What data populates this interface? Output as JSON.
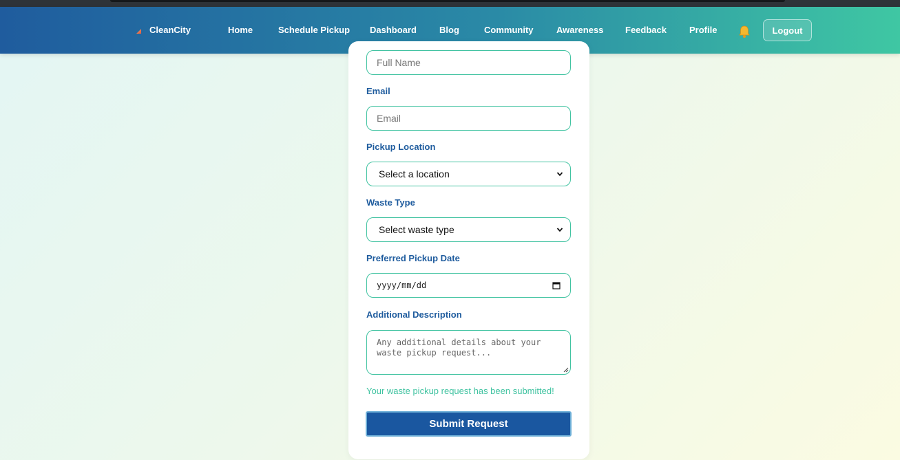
{
  "nav": {
    "brand": "CleanCity",
    "links": [
      "Home",
      "Schedule Pickup",
      "Dashboard",
      "Blog",
      "Community",
      "Awareness",
      "Feedback",
      "Profile"
    ],
    "logout": "Logout"
  },
  "form": {
    "full_name_placeholder": "Full Name",
    "email_label": "Email",
    "email_placeholder": "Email",
    "location_label": "Pickup Location",
    "location_value": "Select a location",
    "waste_label": "Waste Type",
    "waste_value": "Select waste type",
    "date_label": "Preferred Pickup Date",
    "date_placeholder": "yyyy/mm/dd",
    "description_label": "Additional Description",
    "description_placeholder": "Any additional details about your waste pickup request...",
    "success_message": "Your waste pickup request has been submitted!",
    "submit_label": "Submit Request"
  },
  "colors": {
    "accent": "#41c3a1",
    "primary": "#1a57a0",
    "label": "#1f5c9e"
  }
}
